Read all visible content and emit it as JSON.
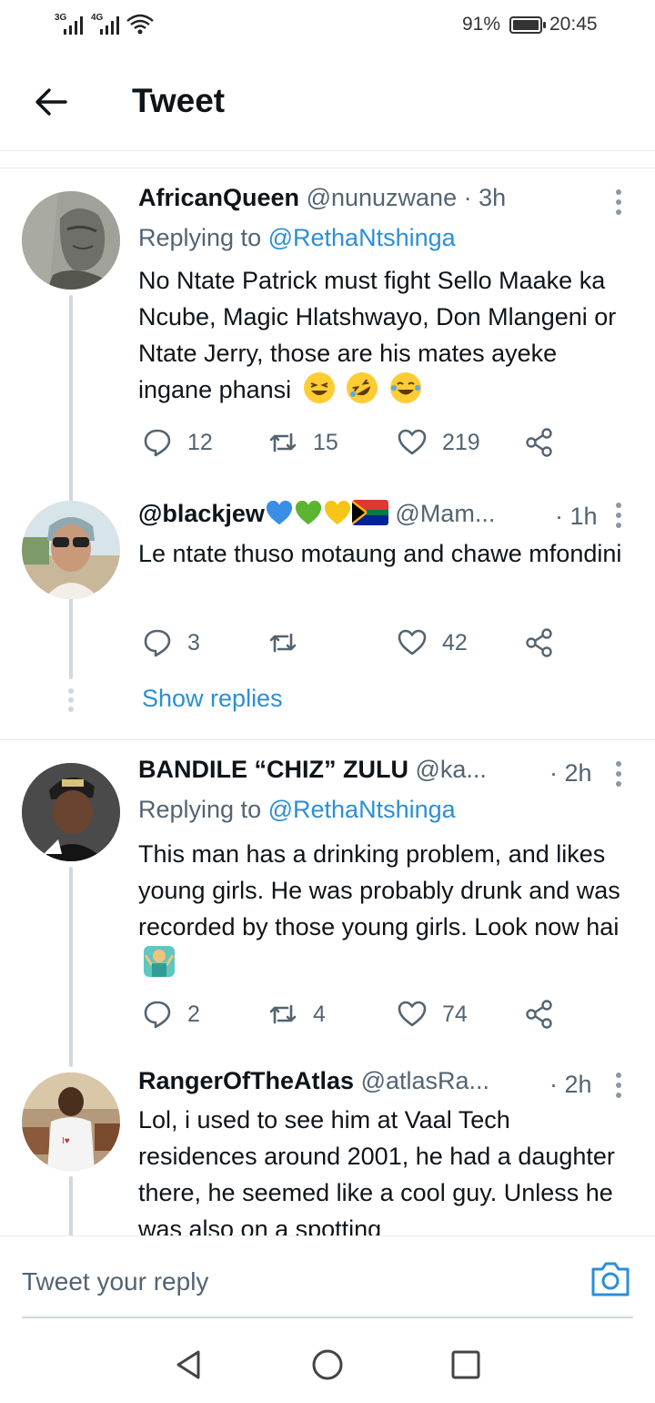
{
  "status": {
    "signal1": "3G",
    "signal2": "4G",
    "battery": "91%",
    "time": "20:45"
  },
  "header": {
    "title": "Tweet"
  },
  "tweets": [
    {
      "name": "AfricanQueen",
      "handle": "@nunuzwane",
      "time": "· 3h",
      "reply_prefix": "Replying to",
      "reply_mention": "@RethaNtshinga",
      "text": "No Ntate Patrick must fight Sello Maake ka Ncube, Magic Hlatshwayo, Don Mlangeni or Ntate Jerry, those are his mates ayeke ingane phansi",
      "replies": "12",
      "retweets": "15",
      "likes": "219"
    },
    {
      "name": "@blackjew",
      "handle": "@Mam...",
      "time": "· 1h",
      "text": "Le ntate thuso motaung and chawe mfondini",
      "replies": "3",
      "retweets": "",
      "likes": "42"
    },
    {
      "name": "BANDILE “CHIZ” ZULU",
      "handle": "@ka...",
      "time": "· 2h",
      "reply_prefix": "Replying to",
      "reply_mention": "@RethaNtshinga",
      "text": "This man has a drinking problem, and likes young girls. He was probably drunk and was recorded by those young girls. Look now hai",
      "replies": "2",
      "retweets": "4",
      "likes": "74"
    },
    {
      "name": "RangerOfTheAtlas",
      "handle": "@atlasRa...",
      "time": "· 2h",
      "text": "Lol, i used to see him at Vaal Tech residences around 2001, he had a daughter there, he seemed like a cool guy. Unless he was also on a spotting"
    }
  ],
  "show_replies": "Show replies",
  "reply_bar": {
    "placeholder": "Tweet your reply"
  },
  "colors": {
    "link": "#2b8fd6",
    "muted": "#536471",
    "thread": "#cfd9de"
  }
}
